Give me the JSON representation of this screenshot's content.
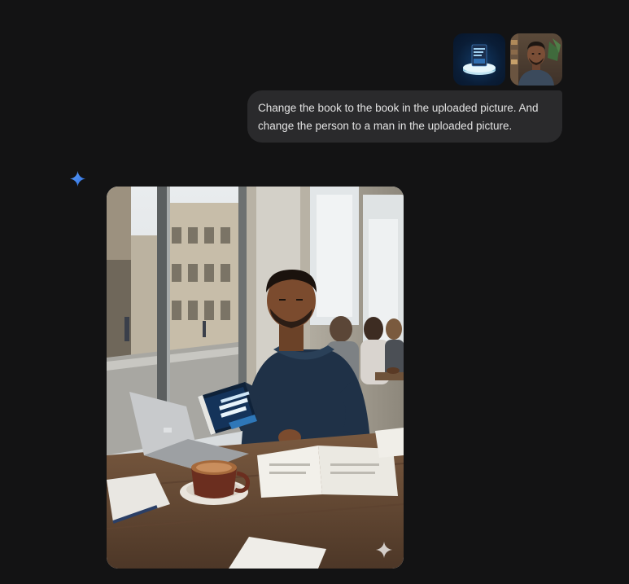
{
  "conversation": {
    "user_message": {
      "attachments": [
        {
          "type": "image",
          "description_icon": "book-thumbnail-icon"
        },
        {
          "type": "image",
          "description_icon": "person-thumbnail-icon"
        }
      ],
      "text": "Change the book to the book in the uploaded picture. And change the person to a man in the uploaded picture."
    },
    "model_response": {
      "icon": "gemini-spark-icon",
      "image_watermark_icon": "spark-watermark-icon",
      "book_cover_lines": [
        "DIGITAL",
        "PRODUCT",
        "BUILDER"
      ]
    }
  },
  "colors": {
    "background": "#131314",
    "user_bubble": "#2a2a2c",
    "text": "#e3e3e3",
    "gemini_blue": "#4b8bf5"
  }
}
